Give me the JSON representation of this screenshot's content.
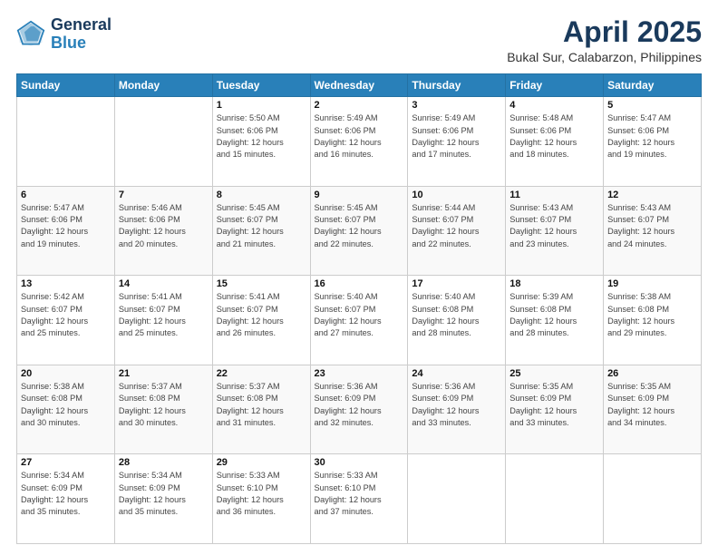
{
  "header": {
    "logo_line1": "General",
    "logo_line2": "Blue",
    "month_year": "April 2025",
    "location": "Bukal Sur, Calabarzon, Philippines"
  },
  "weekdays": [
    "Sunday",
    "Monday",
    "Tuesday",
    "Wednesday",
    "Thursday",
    "Friday",
    "Saturday"
  ],
  "weeks": [
    [
      {
        "day": "",
        "info": ""
      },
      {
        "day": "",
        "info": ""
      },
      {
        "day": "1",
        "info": "Sunrise: 5:50 AM\nSunset: 6:06 PM\nDaylight: 12 hours\nand 15 minutes."
      },
      {
        "day": "2",
        "info": "Sunrise: 5:49 AM\nSunset: 6:06 PM\nDaylight: 12 hours\nand 16 minutes."
      },
      {
        "day": "3",
        "info": "Sunrise: 5:49 AM\nSunset: 6:06 PM\nDaylight: 12 hours\nand 17 minutes."
      },
      {
        "day": "4",
        "info": "Sunrise: 5:48 AM\nSunset: 6:06 PM\nDaylight: 12 hours\nand 18 minutes."
      },
      {
        "day": "5",
        "info": "Sunrise: 5:47 AM\nSunset: 6:06 PM\nDaylight: 12 hours\nand 19 minutes."
      }
    ],
    [
      {
        "day": "6",
        "info": "Sunrise: 5:47 AM\nSunset: 6:06 PM\nDaylight: 12 hours\nand 19 minutes."
      },
      {
        "day": "7",
        "info": "Sunrise: 5:46 AM\nSunset: 6:06 PM\nDaylight: 12 hours\nand 20 minutes."
      },
      {
        "day": "8",
        "info": "Sunrise: 5:45 AM\nSunset: 6:07 PM\nDaylight: 12 hours\nand 21 minutes."
      },
      {
        "day": "9",
        "info": "Sunrise: 5:45 AM\nSunset: 6:07 PM\nDaylight: 12 hours\nand 22 minutes."
      },
      {
        "day": "10",
        "info": "Sunrise: 5:44 AM\nSunset: 6:07 PM\nDaylight: 12 hours\nand 22 minutes."
      },
      {
        "day": "11",
        "info": "Sunrise: 5:43 AM\nSunset: 6:07 PM\nDaylight: 12 hours\nand 23 minutes."
      },
      {
        "day": "12",
        "info": "Sunrise: 5:43 AM\nSunset: 6:07 PM\nDaylight: 12 hours\nand 24 minutes."
      }
    ],
    [
      {
        "day": "13",
        "info": "Sunrise: 5:42 AM\nSunset: 6:07 PM\nDaylight: 12 hours\nand 25 minutes."
      },
      {
        "day": "14",
        "info": "Sunrise: 5:41 AM\nSunset: 6:07 PM\nDaylight: 12 hours\nand 25 minutes."
      },
      {
        "day": "15",
        "info": "Sunrise: 5:41 AM\nSunset: 6:07 PM\nDaylight: 12 hours\nand 26 minutes."
      },
      {
        "day": "16",
        "info": "Sunrise: 5:40 AM\nSunset: 6:07 PM\nDaylight: 12 hours\nand 27 minutes."
      },
      {
        "day": "17",
        "info": "Sunrise: 5:40 AM\nSunset: 6:08 PM\nDaylight: 12 hours\nand 28 minutes."
      },
      {
        "day": "18",
        "info": "Sunrise: 5:39 AM\nSunset: 6:08 PM\nDaylight: 12 hours\nand 28 minutes."
      },
      {
        "day": "19",
        "info": "Sunrise: 5:38 AM\nSunset: 6:08 PM\nDaylight: 12 hours\nand 29 minutes."
      }
    ],
    [
      {
        "day": "20",
        "info": "Sunrise: 5:38 AM\nSunset: 6:08 PM\nDaylight: 12 hours\nand 30 minutes."
      },
      {
        "day": "21",
        "info": "Sunrise: 5:37 AM\nSunset: 6:08 PM\nDaylight: 12 hours\nand 30 minutes."
      },
      {
        "day": "22",
        "info": "Sunrise: 5:37 AM\nSunset: 6:08 PM\nDaylight: 12 hours\nand 31 minutes."
      },
      {
        "day": "23",
        "info": "Sunrise: 5:36 AM\nSunset: 6:09 PM\nDaylight: 12 hours\nand 32 minutes."
      },
      {
        "day": "24",
        "info": "Sunrise: 5:36 AM\nSunset: 6:09 PM\nDaylight: 12 hours\nand 33 minutes."
      },
      {
        "day": "25",
        "info": "Sunrise: 5:35 AM\nSunset: 6:09 PM\nDaylight: 12 hours\nand 33 minutes."
      },
      {
        "day": "26",
        "info": "Sunrise: 5:35 AM\nSunset: 6:09 PM\nDaylight: 12 hours\nand 34 minutes."
      }
    ],
    [
      {
        "day": "27",
        "info": "Sunrise: 5:34 AM\nSunset: 6:09 PM\nDaylight: 12 hours\nand 35 minutes."
      },
      {
        "day": "28",
        "info": "Sunrise: 5:34 AM\nSunset: 6:09 PM\nDaylight: 12 hours\nand 35 minutes."
      },
      {
        "day": "29",
        "info": "Sunrise: 5:33 AM\nSunset: 6:10 PM\nDaylight: 12 hours\nand 36 minutes."
      },
      {
        "day": "30",
        "info": "Sunrise: 5:33 AM\nSunset: 6:10 PM\nDaylight: 12 hours\nand 37 minutes."
      },
      {
        "day": "",
        "info": ""
      },
      {
        "day": "",
        "info": ""
      },
      {
        "day": "",
        "info": ""
      }
    ]
  ]
}
